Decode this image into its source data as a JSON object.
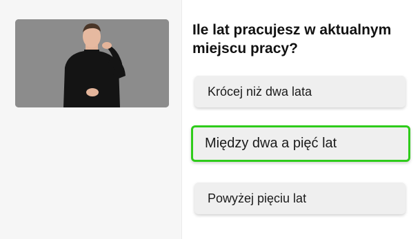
{
  "question": {
    "text": "Ile lat pracujesz w aktualnym miejscu pracy?"
  },
  "video": {
    "description_icon": "sign-language-video"
  },
  "options": [
    {
      "label": "Krócej niż dwa lata",
      "selected": false
    },
    {
      "label": "Między dwa a pięć lat",
      "selected": true
    },
    {
      "label": "Powyżej pięciu lat",
      "selected": false
    }
  ],
  "colors": {
    "selected_border": "#2ecc1a",
    "option_bg": "#efefef",
    "video_bg": "#8c8c8c"
  }
}
